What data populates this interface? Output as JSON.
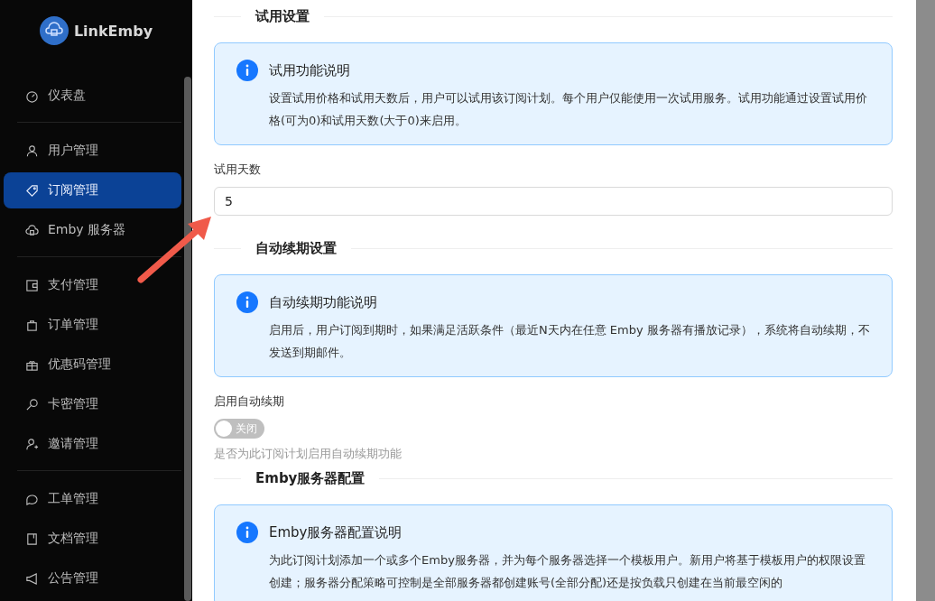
{
  "sidebar": {
    "logo": {
      "text": "LinkEmby"
    },
    "groups": [
      [
        {
          "label": "仪表盘",
          "kind": "gauge",
          "selected": false
        }
      ],
      [
        {
          "label": "用户管理",
          "kind": "user",
          "selected": false
        },
        {
          "label": "订阅管理",
          "kind": "tag",
          "selected": true
        },
        {
          "label": "Emby 服务器",
          "kind": "cloud",
          "selected": false
        }
      ],
      [
        {
          "label": "支付管理",
          "kind": "wallet",
          "selected": false
        },
        {
          "label": "订单管理",
          "kind": "bag",
          "selected": false
        },
        {
          "label": "优惠码管理",
          "kind": "gift",
          "selected": false
        },
        {
          "label": "卡密管理",
          "kind": "key",
          "selected": false
        },
        {
          "label": "邀请管理",
          "kind": "user-plus",
          "selected": false
        }
      ],
      [
        {
          "label": "工单管理",
          "kind": "chat",
          "selected": false
        },
        {
          "label": "文档管理",
          "kind": "book",
          "selected": false
        },
        {
          "label": "公告管理",
          "kind": "megaphone",
          "selected": false
        }
      ]
    ]
  },
  "form": [
    {
      "kind": "section",
      "title": "试用设置"
    },
    {
      "kind": "info",
      "title": "试用功能说明",
      "body": "设置试用价格和试用天数后，用户可以试用该订阅计划。每个用户仅能使用一次试用服务。试用功能通过设置试用价格(可为0)和试用天数(大于0)来启用。"
    },
    {
      "kind": "field",
      "label": "试用天数",
      "value": "5"
    },
    {
      "kind": "section",
      "title": "自动续期设置"
    },
    {
      "kind": "info",
      "title": "自动续期功能说明",
      "body": "启用后，用户订阅到期时，如果满足活跃条件（最近N天内在任意 Emby 服务器有播放记录），系统将自动续期，不发送到期邮件。"
    },
    {
      "kind": "switch",
      "label": "启用自动续期",
      "on": false,
      "state_label": "关闭",
      "hint": "是否为此订阅计划启用自动续期功能"
    },
    {
      "kind": "section",
      "title": "Emby服务器配置"
    },
    {
      "kind": "info",
      "title": "Emby服务器配置说明",
      "body": "为此订阅计划添加一个或多个Emby服务器，并为每个服务器选择一个模板用户。新用户将基于模板用户的权限设置创建；服务器分配策略可控制是全部服务器都创建账号(全部分配)还是按负载只创建在当前最空闲的"
    }
  ]
}
